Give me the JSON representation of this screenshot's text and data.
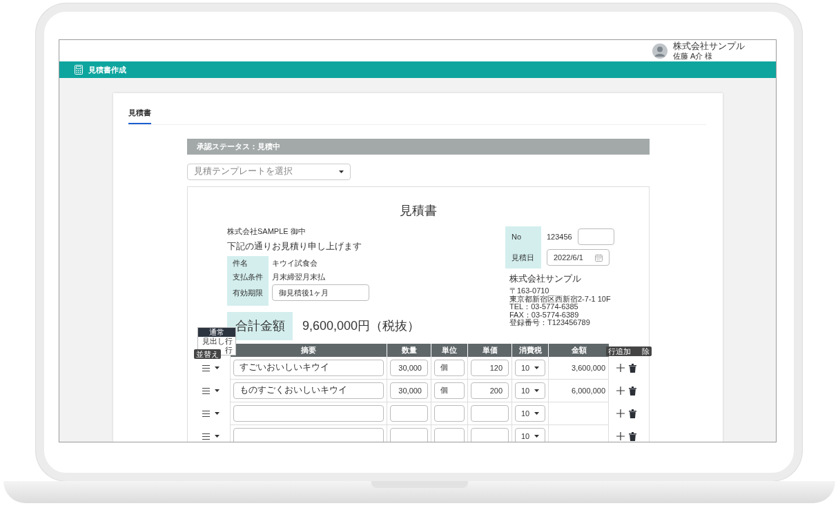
{
  "header": {
    "company": "株式会社サンプル",
    "user": "佐藤 A介 様"
  },
  "app_bar": {
    "title": "見積書作成"
  },
  "tabs": [
    {
      "label": "見積書",
      "selected": true
    }
  ],
  "status": "承認ステータス：見積中",
  "template_select": {
    "placeholder": "見積テンプレートを選択"
  },
  "document": {
    "title": "見積書",
    "recipient": "株式会社SAMPLE 御中",
    "greeting": "下記の通りお見積り申し上げます",
    "details": [
      {
        "label": "件名",
        "value": "キウイ試食会",
        "kind": "text"
      },
      {
        "label": "支払条件",
        "value": "月末締翌月末払",
        "kind": "text"
      },
      {
        "label": "有効期限",
        "value": "御見積後1ヶ月",
        "kind": "input"
      }
    ],
    "total": {
      "label": "合計金額",
      "value": "9,600,000円（税抜）"
    },
    "number": {
      "label": "No",
      "value": "123456"
    },
    "date": {
      "label": "見積日",
      "value": "2022/6/1"
    },
    "issuer": {
      "name": "株式会社サンプル",
      "lines": [
        "〒163-0710",
        "東京都新宿区西新宿2-7-1 10F",
        "TEL：03-5774-6385",
        "FAX：03-5774-6389",
        "登録番号：T123456789"
      ]
    },
    "table": {
      "columns": [
        "摘要",
        "数量",
        "単位",
        "単価",
        "消費税",
        "金額"
      ],
      "rows": [
        {
          "description": "すごいおいしいキウイ",
          "quantity": "30,000",
          "unit": "個",
          "unit_price": "120",
          "tax": "10",
          "amount": "3,600,000"
        },
        {
          "description": "ものすごくおいしいキウイ",
          "quantity": "30,000",
          "unit": "個",
          "unit_price": "200",
          "tax": "10",
          "amount": "6,000,000"
        },
        {
          "tax": "10"
        },
        {
          "tax": "10"
        }
      ]
    },
    "row_type_menu": [
      {
        "label": "通常",
        "selected": true
      },
      {
        "label": "見出し行",
        "selected": false
      },
      {
        "label": "行",
        "selected": false
      }
    ],
    "tooltips": {
      "sort": "並替え",
      "add_row": "行追加",
      "delete": "除"
    }
  }
}
